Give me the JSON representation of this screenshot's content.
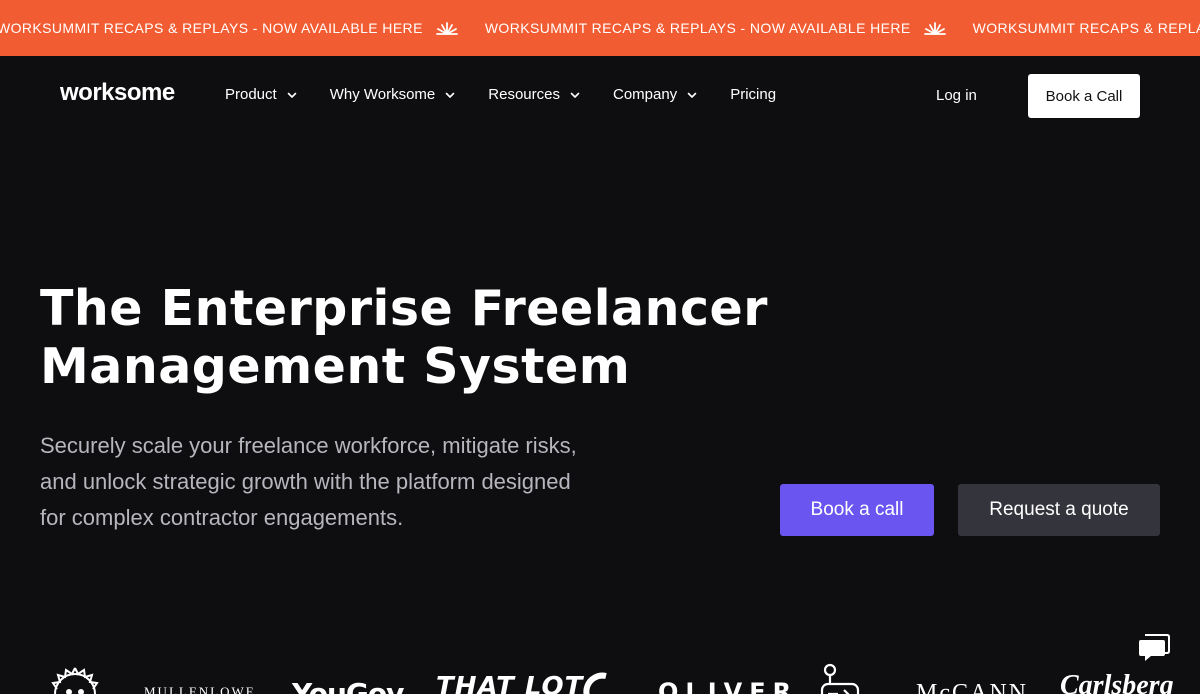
{
  "banner": {
    "text": "WORKSUMMIT RECAPS & REPLAYS - NOW AVAILABLE HERE",
    "icon": "sunburst-icon",
    "background": "#f25c32"
  },
  "nav": {
    "logo": "worksome",
    "items": [
      {
        "label": "Product",
        "has_dropdown": true
      },
      {
        "label": "Why Worksome",
        "has_dropdown": true
      },
      {
        "label": "Resources",
        "has_dropdown": true
      },
      {
        "label": "Company",
        "has_dropdown": true
      },
      {
        "label": "Pricing",
        "has_dropdown": false
      }
    ],
    "login": "Log in",
    "cta": "Book a Call"
  },
  "hero": {
    "title_lines": [
      "The Enterprise Freelancer",
      "Management System"
    ],
    "subtitle_lines": [
      "Securely scale your freelance workforce, mitigate risks,",
      "and unlock strategic growth with the platform designed",
      "for complex contractor engagements."
    ],
    "primary_cta": "Book a call",
    "secondary_cta": "Request a quote"
  },
  "clients": {
    "mullenlowe": "MULLENLOWE",
    "yougov": "YouGov",
    "thatlot": "THAT LOT",
    "oliver": "OLIVER",
    "mccann": "McCANN",
    "carlsberg": "Carlsberg"
  },
  "colors": {
    "page_bg": "#0e0e11",
    "accent": "#6b55f0",
    "secondary_button": "#34343c",
    "banner": "#f25c32"
  }
}
